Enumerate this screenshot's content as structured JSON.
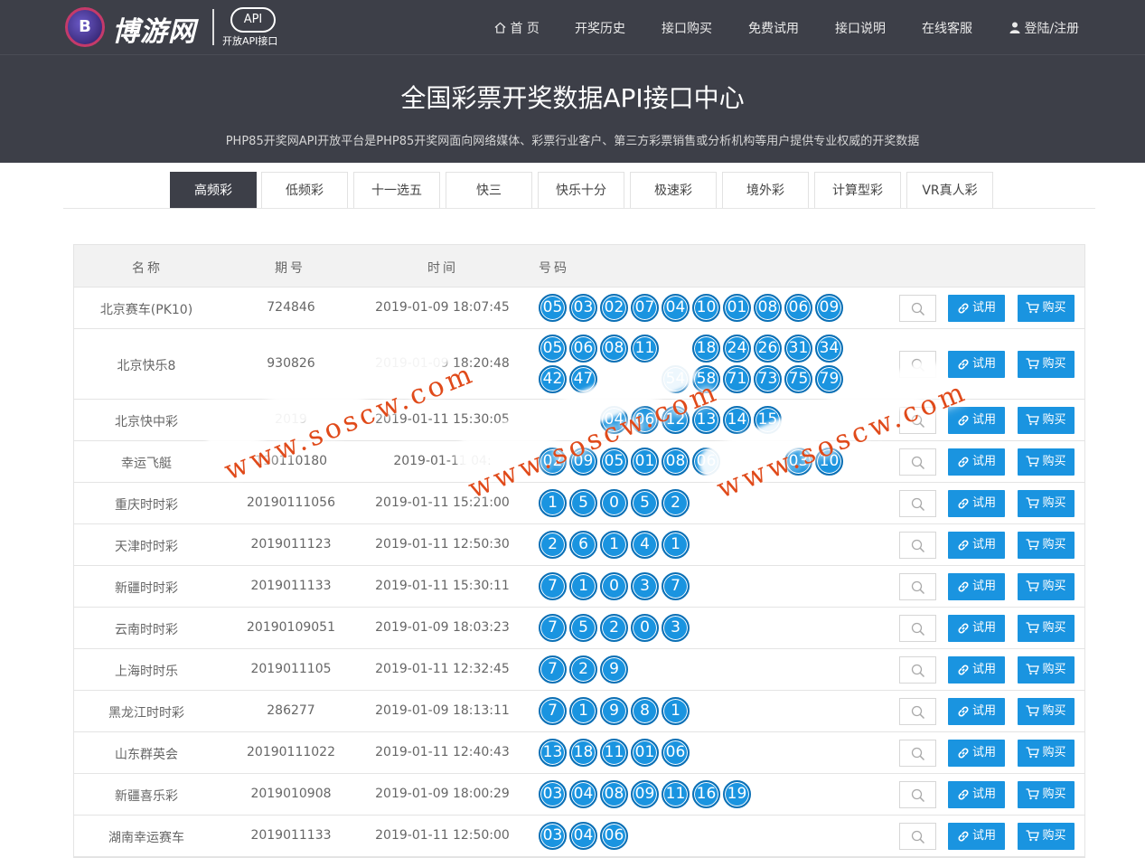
{
  "brand": {
    "logo_letter": "B",
    "logo_text": "博游网",
    "api_badge": "API",
    "api_sub": "开放API接口"
  },
  "nav": {
    "home": "首 页",
    "history": "开奖历史",
    "buy": "接口购买",
    "trial": "免费试用",
    "docs": "接口说明",
    "service": "在线客服",
    "login": "登陆/注册"
  },
  "hero": {
    "title": "全国彩票开奖数据API接口中心",
    "subtitle": "PHP85开奖网API开放平台是PHP85开奖网面向网络媒体、彩票行业客户、第三方彩票销售或分析机构等用户提供专业权威的开奖数据"
  },
  "tabs": [
    "高频彩",
    "低频彩",
    "十一选五",
    "快三",
    "快乐十分",
    "极速彩",
    "境外彩",
    "计算型彩",
    "VR真人彩"
  ],
  "table": {
    "headers": {
      "name": "名称",
      "issue": "期号",
      "time": "时间",
      "numbers": "号码"
    },
    "try_label": "试用",
    "buy_label": "购买",
    "rows": [
      {
        "name": "北京赛车(PK10)",
        "issue": "724846",
        "time": "2019-01-09 18:07:45",
        "numbers": [
          "05",
          "03",
          "02",
          "07",
          "04",
          "10",
          "01",
          "08",
          "06",
          "09"
        ]
      },
      {
        "name": "北京快乐8",
        "issue": "930826",
        "time": "2019-01-09 18:20:48",
        "numbers": [
          "05",
          "06",
          "08",
          "11",
          "",
          "18",
          "24",
          "26",
          "31",
          "34",
          "42",
          "47",
          "",
          "",
          "54",
          "58",
          "71",
          "73",
          "75",
          "79"
        ]
      },
      {
        "name": "北京快中彩",
        "issue": "2019",
        "time": "2019-01-11 15:30:05",
        "numbers": [
          "",
          "",
          "04",
          "06",
          "12",
          "13",
          "14",
          "15",
          ""
        ]
      },
      {
        "name": "幸运飞艇",
        "issue": "190110180",
        "time": "2019-01-11 04:",
        "numbers": [
          "02",
          "09",
          "05",
          "01",
          "08",
          "06",
          "",
          "",
          "03",
          "10"
        ]
      },
      {
        "name": "重庆时时彩",
        "issue": "20190111056",
        "time": "2019-01-11 15:21:00",
        "numbers": [
          "1",
          "5",
          "0",
          "5",
          "2"
        ]
      },
      {
        "name": "天津时时彩",
        "issue": "2019011123",
        "time": "2019-01-11 12:50:30",
        "numbers": [
          "2",
          "6",
          "1",
          "4",
          "1"
        ]
      },
      {
        "name": "新疆时时彩",
        "issue": "2019011133",
        "time": "2019-01-11 15:30:11",
        "numbers": [
          "7",
          "1",
          "0",
          "3",
          "7"
        ]
      },
      {
        "name": "云南时时彩",
        "issue": "20190109051",
        "time": "2019-01-09 18:03:23",
        "numbers": [
          "7",
          "5",
          "2",
          "0",
          "3"
        ]
      },
      {
        "name": "上海时时乐",
        "issue": "2019011105",
        "time": "2019-01-11 12:32:45",
        "numbers": [
          "7",
          "2",
          "9"
        ]
      },
      {
        "name": "黑龙江时时彩",
        "issue": "286277",
        "time": "2019-01-09 18:13:11",
        "numbers": [
          "7",
          "1",
          "9",
          "8",
          "1"
        ]
      },
      {
        "name": "山东群英会",
        "issue": "20190111022",
        "time": "2019-01-11 12:40:43",
        "numbers": [
          "13",
          "18",
          "11",
          "01",
          "06"
        ]
      },
      {
        "name": "新疆喜乐彩",
        "issue": "2019010908",
        "time": "2019-01-09 18:00:29",
        "numbers": [
          "03",
          "04",
          "08",
          "09",
          "11",
          "16",
          "19"
        ]
      },
      {
        "name": "湖南幸运赛车",
        "issue": "2019011133",
        "time": "2019-01-11 12:50:00",
        "numbers": [
          "03",
          "04",
          "06"
        ]
      }
    ]
  },
  "watermark": {
    "text": "www.soscw.com"
  },
  "colors": {
    "header_bg": "#3d3f48",
    "accent": "#1a94e0",
    "ball_border": "#0a6fb5",
    "watermark": "#e04a1a"
  }
}
